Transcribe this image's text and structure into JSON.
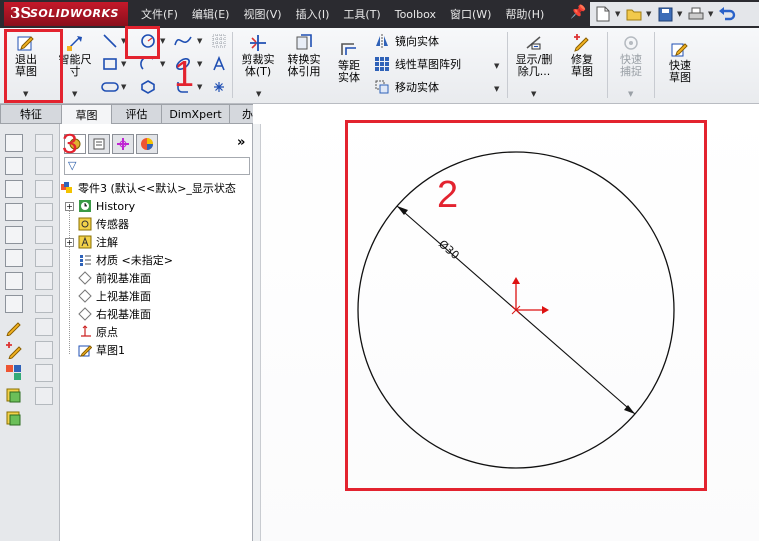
{
  "app": {
    "logo_mark": "3S",
    "logo_text": "SOLIDWORKS"
  },
  "menu": [
    {
      "id": "file",
      "label": "文件(F)"
    },
    {
      "id": "edit",
      "label": "编辑(E)"
    },
    {
      "id": "view",
      "label": "视图(V)"
    },
    {
      "id": "insert",
      "label": "插入(I)"
    },
    {
      "id": "tools",
      "label": "工具(T)"
    },
    {
      "id": "toolbox",
      "label": "Toolbox"
    },
    {
      "id": "window",
      "label": "窗口(W)"
    },
    {
      "id": "help",
      "label": "帮助(H)"
    }
  ],
  "command_manager": {
    "exit_sketch": "退出草图",
    "smart_dimension": "智能尺寸",
    "trim": "剪裁实体(T)",
    "convert": "转换实体引用",
    "offset": "等距实体",
    "mirror": "镜向实体",
    "linear_pattern": "线性草图阵列",
    "move": "移动实体",
    "show_delete": "显示/删除几...",
    "repair": "修复草图",
    "quick_snap": "快速捕捉",
    "rapid_sketch": "快速草图"
  },
  "tabs": [
    {
      "label": "特征",
      "active": false
    },
    {
      "label": "草图",
      "active": true
    },
    {
      "label": "评估",
      "active": false
    },
    {
      "label": "DimXpert",
      "active": false
    },
    {
      "label": "办公室产品",
      "active": false
    }
  ],
  "feature_tree": {
    "part": "零件3 (默认<<默认>_显示状态",
    "items": [
      {
        "label": "History",
        "icon": "history-icon",
        "expandable": true
      },
      {
        "label": "传感器",
        "icon": "sensor-icon",
        "expandable": false
      },
      {
        "label": "注解",
        "icon": "annotation-icon",
        "expandable": true
      },
      {
        "label": "材质 <未指定>",
        "icon": "material-icon",
        "expandable": false
      },
      {
        "label": "前视基准面",
        "icon": "plane-icon",
        "expandable": false
      },
      {
        "label": "上视基准面",
        "icon": "plane-icon",
        "expandable": false
      },
      {
        "label": "右视基准面",
        "icon": "plane-icon",
        "expandable": false
      },
      {
        "label": "原点",
        "icon": "origin-icon",
        "expandable": false
      },
      {
        "label": "草图1",
        "icon": "sketch-icon",
        "expandable": false
      }
    ]
  },
  "annotations": {
    "marker1": "1",
    "marker2": "2",
    "marker3": "3",
    "dimension": "Ø30"
  },
  "colors": {
    "marker_red": "#e3232f",
    "titlebar": "#2b2b30",
    "sketch_blue": "#1f4fb3"
  }
}
